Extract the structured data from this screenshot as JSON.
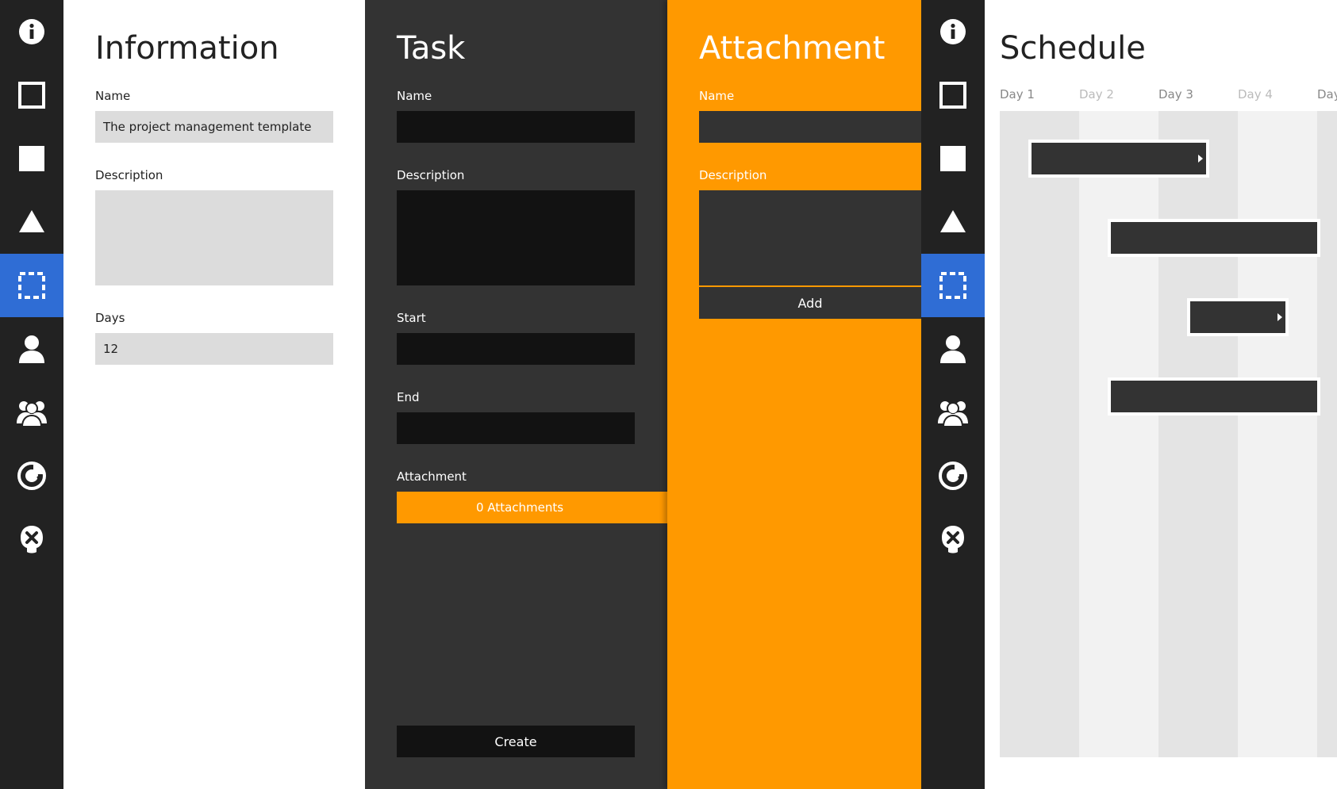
{
  "sidebar": {
    "items": [
      {
        "icon": "info-icon"
      },
      {
        "icon": "square-outline-icon"
      },
      {
        "icon": "square-filled-icon"
      },
      {
        "icon": "triangle-icon"
      },
      {
        "icon": "dashed-selection-icon",
        "active": true
      },
      {
        "icon": "user-icon"
      },
      {
        "icon": "users-group-icon"
      },
      {
        "icon": "chart-icon"
      },
      {
        "icon": "close-user-icon"
      }
    ],
    "active_color": "#2f6dd5"
  },
  "information": {
    "title": "Information",
    "name_label": "Name",
    "name_value": "The project management template",
    "description_label": "Description",
    "description_value": "",
    "days_label": "Days",
    "days_value": "12"
  },
  "task": {
    "title": "Task",
    "name_label": "Name",
    "description_label": "Description",
    "start_label": "Start",
    "end_label": "End",
    "attachment_label": "Attachment",
    "attachments_button": "0 Attachments",
    "create_button": "Create"
  },
  "attachment": {
    "title": "Attachment",
    "name_label": "Name",
    "description_label": "Description",
    "add_button": "Add",
    "accent": "#ff9900"
  },
  "schedule": {
    "title": "Schedule",
    "days": [
      "Day 1",
      "Day 2",
      "Day 3",
      "Day 4",
      "Day"
    ],
    "tasks": [
      {
        "start_day": 1.4,
        "end_day": 3.6,
        "arrow": true
      },
      {
        "start_day": 2.4,
        "end_day": 5.0,
        "arrow": false
      },
      {
        "start_day": 3.4,
        "end_day": 4.6,
        "arrow": true
      },
      {
        "start_day": 2.4,
        "end_day": 5.0,
        "arrow": false
      }
    ]
  }
}
